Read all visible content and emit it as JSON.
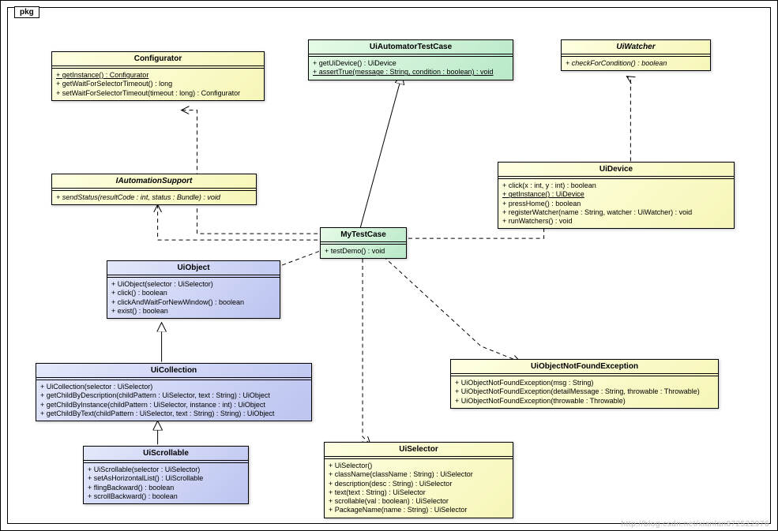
{
  "package_label": "pkg",
  "watermark": "http://blog.csdn.net/xianlan872522976",
  "classes": {
    "configurator": {
      "name": "Configurator",
      "members": [
        {
          "text": "+ getInstance() : Configurator",
          "style": "u"
        },
        {
          "text": "+ getWaitForSelectorTimeout() : long"
        },
        {
          "text": "+ setWaitForSelectorTimeout(timeout : long) : Configurator"
        }
      ]
    },
    "uiautomator": {
      "name": "UiAutomatorTestCase",
      "members": [
        {
          "text": "+ getUiDevice() : UiDevice"
        },
        {
          "text": "+ assertTrue(message : String, condition : boolean) : void",
          "style": "u"
        }
      ]
    },
    "uiwatcher": {
      "name": "UiWatcher",
      "name_style": "i",
      "members": [
        {
          "text": "+ checkForCondition() : boolean",
          "style": "i"
        }
      ]
    },
    "iauto": {
      "name": "IAutomationSupport",
      "name_style": "i",
      "members": [
        {
          "text": "+ sendStatus(resultCode : int, status : Bundle) : void",
          "style": "i"
        }
      ]
    },
    "uidevice": {
      "name": "UiDevice",
      "members": [
        {
          "text": "+ click(x : int, y : int) : boolean"
        },
        {
          "text": "+ getInstance() : UiDevice",
          "style": "u"
        },
        {
          "text": "+ pressHome() : boolean"
        },
        {
          "text": "+ registerWatcher(name : String, watcher : UiWatcher) : void"
        },
        {
          "text": "+ runWatchers() : void"
        }
      ]
    },
    "mytest": {
      "name": "MyTestCase",
      "members": [
        {
          "text": "+ testDemo() : void"
        }
      ]
    },
    "uiobject": {
      "name": "UiObject",
      "members": [
        {
          "text": "+ UiObject(selector : UiSelector)"
        },
        {
          "text": "+ click() : boolean"
        },
        {
          "text": "+ clickAndWaitForNewWindow() : boolean"
        },
        {
          "text": "+ exist() : boolean"
        }
      ]
    },
    "uicollection": {
      "name": "UiCollection",
      "members": [
        {
          "text": "+ UiCollection(selector : UiSelector)"
        },
        {
          "text": "+ getChildByDescription(childPattern : UiSelector, text : String) : UiObject"
        },
        {
          "text": "+ getChildByInstance(childPattern : UiSelector, instance : int) : UiObject"
        },
        {
          "text": "+ getChildByText(childPattern : UiSelector, text : String) : String) : UiObject"
        }
      ]
    },
    "uiscrollable": {
      "name": "UiScrollable",
      "members": [
        {
          "text": "+ UiScrollable(selector : UiSelector)"
        },
        {
          "text": "+ setAsHorizontalList() : UiScrollable"
        },
        {
          "text": "+ flingBackward() : boolean"
        },
        {
          "text": "+ scrollBackward() : boolean"
        }
      ]
    },
    "uiexception": {
      "name": "UiObjectNotFoundException",
      "members": [
        {
          "text": "+ UiObjectNotFoundException(msg : String)"
        },
        {
          "text": "+ UiObjectNotFoundException(detailMessage : String, throwable : Throwable)"
        },
        {
          "text": "+ UiObjectNotFoundException(throwable : Throwable)"
        }
      ]
    },
    "uiselector": {
      "name": "UiSelector",
      "members": [
        {
          "text": "+ UiSelector()"
        },
        {
          "text": "+ className(className : String) : UiSelector"
        },
        {
          "text": "+ description(desc : String) : UiSelector"
        },
        {
          "text": "+ text(text : String) : UiSelector"
        },
        {
          "text": "+ scrollable(val : boolean) : UiSelector"
        },
        {
          "text": "+ PackageName(name : String) : UiSelector"
        }
      ]
    }
  },
  "chart_data": {
    "type": "uml_class_diagram",
    "package": "pkg",
    "classes": [
      {
        "id": "Configurator",
        "color": "yellow",
        "members": [
          "+getInstance():Configurator {static}",
          "+getWaitForSelectorTimeout():long",
          "+setWaitForSelectorTimeout(timeout:long):Configurator"
        ]
      },
      {
        "id": "UiAutomatorTestCase",
        "color": "green",
        "members": [
          "+getUiDevice():UiDevice",
          "+assertTrue(message:String,condition:boolean):void {static}"
        ]
      },
      {
        "id": "UiWatcher",
        "stereotype": "interface",
        "color": "yellow",
        "members": [
          "+checkForCondition():boolean {abstract}"
        ]
      },
      {
        "id": "IAutomationSupport",
        "stereotype": "interface",
        "color": "yellow",
        "members": [
          "+sendStatus(resultCode:int,status:Bundle):void {abstract}"
        ]
      },
      {
        "id": "UiDevice",
        "color": "yellow",
        "members": [
          "+click(x:int,y:int):boolean",
          "+getInstance():UiDevice {static}",
          "+pressHome():boolean",
          "+registerWatcher(name:String,watcher:UiWatcher):void",
          "+runWatchers():void"
        ]
      },
      {
        "id": "MyTestCase",
        "color": "green",
        "members": [
          "+testDemo():void"
        ]
      },
      {
        "id": "UiObject",
        "color": "blue",
        "members": [
          "+UiObject(selector:UiSelector)",
          "+click():boolean",
          "+clickAndWaitForNewWindow():boolean",
          "+exist():boolean"
        ]
      },
      {
        "id": "UiCollection",
        "color": "blue",
        "members": [
          "+UiCollection(selector:UiSelector)",
          "+getChildByDescription(childPattern:UiSelector,text:String):UiObject",
          "+getChildByInstance(childPattern:UiSelector,instance:int):UiObject",
          "+getChildByText(childPattern:UiSelector,text:String):UiObject"
        ]
      },
      {
        "id": "UiScrollable",
        "color": "blue",
        "members": [
          "+UiScrollable(selector:UiSelector)",
          "+setAsHorizontalList():UiScrollable",
          "+flingBackward():boolean",
          "+scrollBackward():boolean"
        ]
      },
      {
        "id": "UiObjectNotFoundException",
        "color": "yellow",
        "members": [
          "+UiObjectNotFoundException(msg:String)",
          "+UiObjectNotFoundException(detailMessage:String,throwable:Throwable)",
          "+UiObjectNotFoundException(throwable:Throwable)"
        ]
      },
      {
        "id": "UiSelector",
        "color": "yellow",
        "members": [
          "+UiSelector()",
          "+className(className:String):UiSelector",
          "+description(desc:String):UiSelector",
          "+text(text:String):UiSelector",
          "+scrollable(val:boolean):UiSelector",
          "+PackageName(name:String):UiSelector"
        ]
      }
    ],
    "relations": [
      {
        "from": "MyTestCase",
        "to": "UiAutomatorTestCase",
        "type": "generalization"
      },
      {
        "from": "UiCollection",
        "to": "UiObject",
        "type": "generalization"
      },
      {
        "from": "UiScrollable",
        "to": "UiCollection",
        "type": "generalization"
      },
      {
        "from": "MyTestCase",
        "to": "Configurator",
        "type": "dependency"
      },
      {
        "from": "MyTestCase",
        "to": "IAutomationSupport",
        "type": "dependency"
      },
      {
        "from": "MyTestCase",
        "to": "UiDevice",
        "type": "dependency"
      },
      {
        "from": "MyTestCase",
        "to": "UiObject",
        "type": "dependency"
      },
      {
        "from": "MyTestCase",
        "to": "UiObjectNotFoundException",
        "type": "dependency"
      },
      {
        "from": "MyTestCase",
        "to": "UiSelector",
        "type": "dependency"
      },
      {
        "from": "UiDevice",
        "to": "UiWatcher",
        "type": "dependency"
      }
    ]
  }
}
